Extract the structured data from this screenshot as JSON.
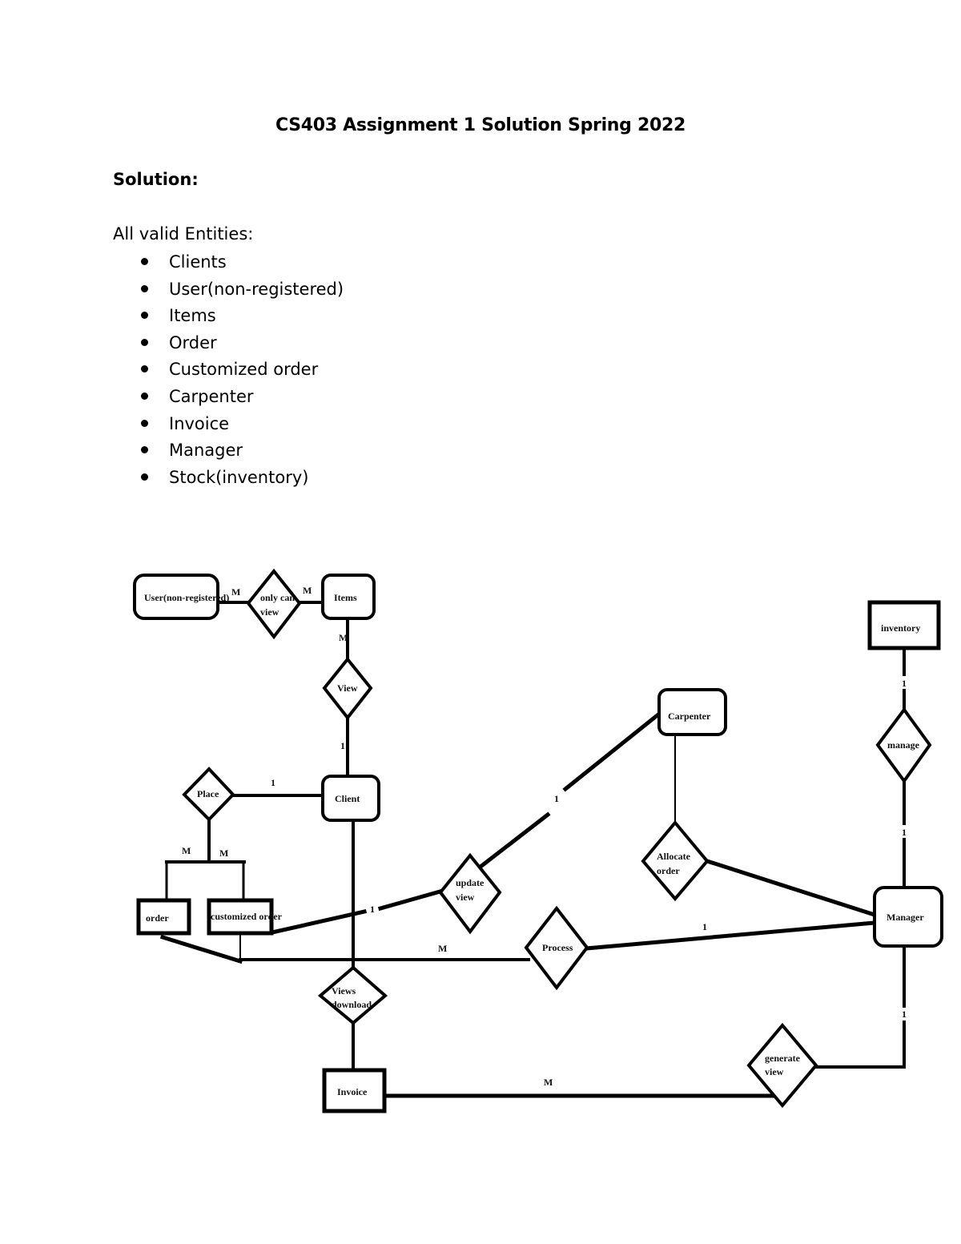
{
  "document": {
    "title": "CS403 Assignment 1 Solution Spring 2022",
    "solution_heading": "Solution:",
    "entities_heading": "All valid Entities:",
    "entities": [
      "Clients",
      "User(non-registered)",
      "Items",
      "Order",
      "Customized order",
      "Carpenter",
      "Invoice",
      "Manager",
      "Stock(inventory)"
    ]
  },
  "diagram": {
    "type": "er-diagram",
    "entities": {
      "user": "User(non-registered)",
      "items": "Items",
      "client": "Client",
      "order": "order",
      "customized_order": "customized order",
      "carpenter": "Carpenter",
      "inventory": "inventory",
      "manager": "Manager",
      "invoice": "Invoice"
    },
    "relationships": {
      "only_can_view": [
        "only can",
        "view"
      ],
      "view": "View",
      "place": "Place",
      "update_view": [
        "update",
        "view"
      ],
      "allocate_order": [
        "Allocate",
        "order"
      ],
      "process": "Process",
      "manage": "manage",
      "views_download": [
        "Views",
        "download"
      ],
      "generate_view": [
        "generate",
        "view"
      ]
    },
    "cardinalities": {
      "user_onlycanview": "M",
      "onlycanview_items": "M",
      "items_view": "M",
      "view_client": "1",
      "place_client": "1",
      "place_order": "M",
      "place_customized": "M",
      "customized_updateview": "1",
      "updateview_carpenter": "1",
      "orders_process": "M",
      "process_manager": "1",
      "inventory_manage": "1",
      "manage_manager": "1",
      "manager_generateview": "1",
      "invoice_generateview": "M"
    }
  }
}
